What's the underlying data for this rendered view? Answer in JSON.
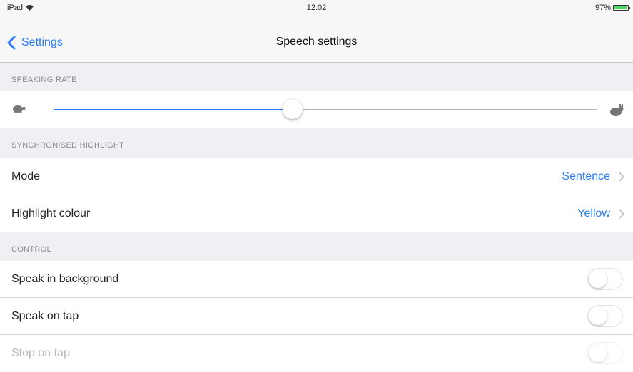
{
  "status_bar": {
    "carrier": "iPad",
    "time": "12:02",
    "battery_text": "97%",
    "battery_level": 0.97,
    "icons": [
      "wifi-icon",
      "battery-icon"
    ]
  },
  "nav": {
    "back_label": "Settings",
    "title": "Speech settings"
  },
  "sections": {
    "speaking_rate": {
      "header": "SPEAKING RATE",
      "slider_value": 0.44,
      "min_icon": "turtle-icon",
      "max_icon": "rabbit-icon"
    },
    "highlight": {
      "header": "SYNCHRONISED HIGHLIGHT",
      "mode_label": "Mode",
      "mode_value": "Sentence",
      "colour_label": "Highlight colour",
      "colour_value": "Yellow"
    },
    "control": {
      "header": "CONTROL",
      "speak_background_label": "Speak in background",
      "speak_background_on": false,
      "speak_tap_label": "Speak on tap",
      "speak_tap_on": false,
      "stop_tap_label": "Stop on tap",
      "stop_tap_on": false
    }
  },
  "colors": {
    "accent": "#2a7bf6",
    "background": "#efeff4",
    "battery": "#4cd964"
  }
}
